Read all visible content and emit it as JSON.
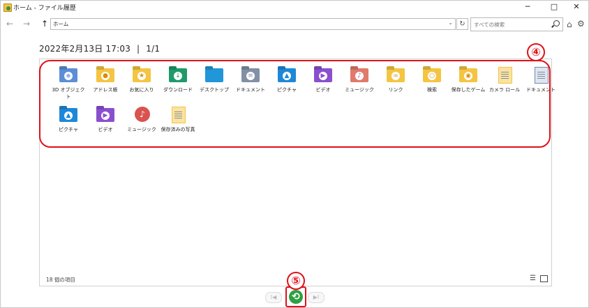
{
  "window": {
    "title": "ホーム - ファイル履歴",
    "minimize": "─",
    "maximize": "□",
    "close": "✕"
  },
  "nav": {
    "back": "←",
    "forward": "→",
    "up": "↑",
    "address_value": "ホーム",
    "search_placeholder": "すべての検索",
    "home_icon": "⌂",
    "settings_icon": "⚙"
  },
  "header": {
    "date": "2022年2月13日 17:03",
    "separator": "|",
    "page": "1/1"
  },
  "items": [
    {
      "label": "3D オブジェクト",
      "icon": "folder-3d-icon",
      "color": "#5b8fd6",
      "glyph": "◆",
      "glyph_color": "#8fb6ef"
    },
    {
      "label": "アドレス帳",
      "icon": "contacts-folder-icon",
      "color": "#f4c542",
      "glyph": "●",
      "glyph_color": "#e08a00"
    },
    {
      "label": "お気に入り",
      "icon": "favorites-folder-icon",
      "color": "#f4c542",
      "glyph": "★",
      "glyph_color": "#e08a00"
    },
    {
      "label": "ダウンロード",
      "icon": "downloads-folder-icon",
      "color": "#1f9a6b",
      "glyph": "↓",
      "glyph_color": "#1f9a6b"
    },
    {
      "label": "デスクトップ",
      "icon": "desktop-folder-icon",
      "color": "#2196d9",
      "glyph": "",
      "glyph_color": "#2196d9"
    },
    {
      "label": "ドキュメント",
      "icon": "documents-folder-icon",
      "color": "#8290a6",
      "glyph": "≡",
      "glyph_color": "#8290a6"
    },
    {
      "label": "ピクチャ",
      "icon": "pictures-folder-icon",
      "color": "#1e88d8",
      "glyph": "▲",
      "glyph_color": "#1e88d8"
    },
    {
      "label": "ビデオ",
      "icon": "videos-folder-icon",
      "color": "#8a4fcf",
      "glyph": "▶",
      "glyph_color": "#8a4fcf"
    },
    {
      "label": "ミュージック",
      "icon": "music-folder-icon",
      "color": "#e07a6a",
      "glyph": "♪",
      "glyph_color": "#c64f9a"
    },
    {
      "label": "リンク",
      "icon": "links-folder-icon",
      "color": "#f4c542",
      "glyph": "∞",
      "glyph_color": "#e08a00"
    },
    {
      "label": "検索",
      "icon": "searches-folder-icon",
      "color": "#f4c542",
      "glyph": "○",
      "glyph_color": "#e08a00"
    },
    {
      "label": "保存したゲーム",
      "icon": "saved-games-folder-icon",
      "color": "#f4c542",
      "glyph": "◉",
      "glyph_color": "#e08a00"
    },
    {
      "label": "カメラ ロール",
      "icon": "camera-roll-file-icon",
      "color": "#fbe3a0",
      "glyph": "",
      "glyph_color": "#f4c542",
      "type": "doc"
    },
    {
      "label": "ドキュメント",
      "icon": "document-file-icon",
      "color": "#dfe6f0",
      "glyph": "",
      "glyph_color": "#6f8bb3",
      "type": "doc"
    },
    {
      "label": "ピクチャ",
      "icon": "pictures-icon",
      "color": "#1e88d8",
      "glyph": "▲",
      "glyph_color": "#1e88d8"
    },
    {
      "label": "ビデオ",
      "icon": "video-icon",
      "color": "#8a4fcf",
      "glyph": "▶",
      "glyph_color": "#8a4fcf"
    },
    {
      "label": "ミュージック",
      "icon": "music-icon",
      "color": "#d9534f",
      "glyph": "♪",
      "glyph_color": "#d9534f",
      "type": "round"
    },
    {
      "label": "保存済みの写真",
      "icon": "saved-pictures-file-icon",
      "color": "#fbe3a0",
      "glyph": "",
      "glyph_color": "#f4c542",
      "type": "doc"
    }
  ],
  "status": {
    "count": "18 個の項目",
    "list_view_icon": "☰"
  },
  "controls": {
    "prev_icon": "I◀",
    "restore_icon": "⟲",
    "next_icon": "▶I"
  },
  "callouts": {
    "four": "④",
    "five": "⑤"
  },
  "colors": {
    "callout_red": "#e0101a",
    "restore_green": "#2fa043"
  }
}
